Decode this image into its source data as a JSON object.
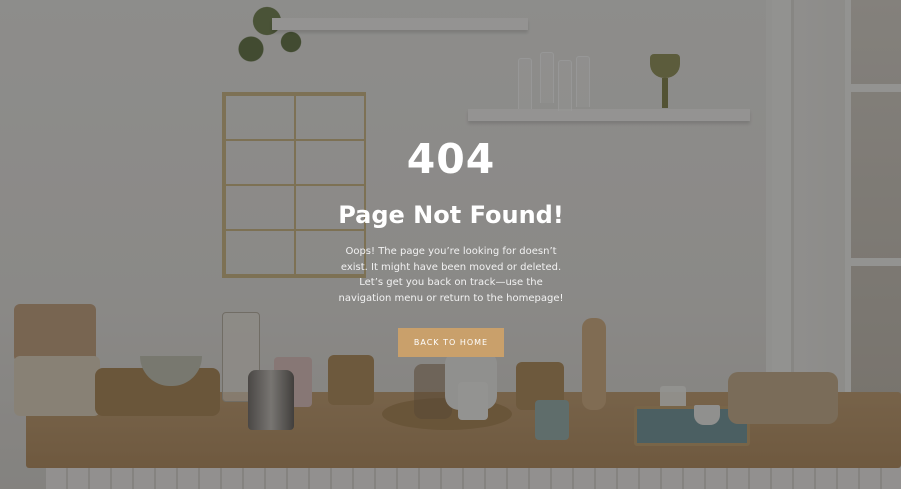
{
  "error": {
    "code": "404",
    "title": "Page Not Found!",
    "description": "Oops! The page you’re looking for doesn’t exist. It might have been moved or deleted. Let’s get you back on track—use the navigation menu or return to the homepage!",
    "button_label": "BACK TO HOME"
  },
  "colors": {
    "button_background": "#c9a06b",
    "overlay": "#000000",
    "text": "#ffffff"
  }
}
